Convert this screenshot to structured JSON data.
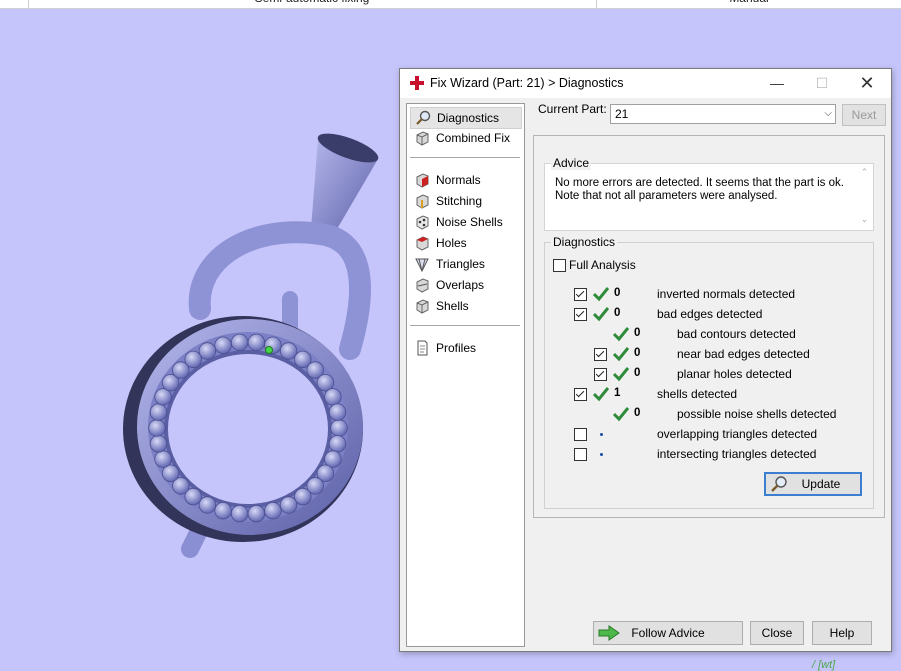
{
  "topbar": {
    "left_text": "Semi-automatic fixing",
    "right_text": "Manual"
  },
  "viewport": {
    "background": "#c6c5fb",
    "model_color": "#8e93d6",
    "corner_label": "/ [wt]"
  },
  "dialog": {
    "title": "Fix Wizard (Part: 21) > Diagnostics",
    "minimize": "—",
    "maximize": "☐",
    "close": "✕"
  },
  "nav": {
    "items": [
      {
        "label": "Diagnostics",
        "icon": "magnifier-icon",
        "active": true
      },
      {
        "label": "Combined Fix",
        "icon": "cube-icon"
      },
      {
        "label": "Normals",
        "icon": "normals-cube-icon"
      },
      {
        "label": "Stitching",
        "icon": "stitching-cube-icon"
      },
      {
        "label": "Noise Shells",
        "icon": "noise-shells-icon"
      },
      {
        "label": "Holes",
        "icon": "holes-cube-icon"
      },
      {
        "label": "Triangles",
        "icon": "triangles-icon"
      },
      {
        "label": "Overlaps",
        "icon": "overlaps-icon"
      },
      {
        "label": "Shells",
        "icon": "shells-icon"
      },
      {
        "label": "Profiles",
        "icon": "document-icon"
      }
    ]
  },
  "current_part": {
    "label": "Current Part:",
    "value": "21",
    "next_label": "Next"
  },
  "advice": {
    "title": "Advice",
    "line1": "No more errors are detected. It seems that the part is ok.",
    "line2": "Note that not all parameters were analysed."
  },
  "diagnostics": {
    "title": "Diagnostics",
    "full_analysis_label": "Full Analysis",
    "rows": [
      {
        "label": "inverted normals detected",
        "count": "0"
      },
      {
        "label": "bad edges detected",
        "count": "0"
      },
      {
        "label": "bad contours detected",
        "count": "0"
      },
      {
        "label": "near bad edges detected",
        "count": "0"
      },
      {
        "label": "planar holes detected",
        "count": "0"
      },
      {
        "label": "shells detected",
        "count": "1"
      },
      {
        "label": "possible noise shells detected",
        "count": "0"
      },
      {
        "label": "overlapping triangles detected",
        "count": ""
      },
      {
        "label": "intersecting triangles detected",
        "count": ""
      }
    ],
    "update_label": "Update"
  },
  "footer": {
    "follow_label": "Follow Advice",
    "close_label": "Close",
    "help_label": "Help"
  },
  "colors": {
    "accent": "#3c7fd1",
    "tick_green": "#2e8b3a",
    "title_icon_red": "#c8102e"
  }
}
